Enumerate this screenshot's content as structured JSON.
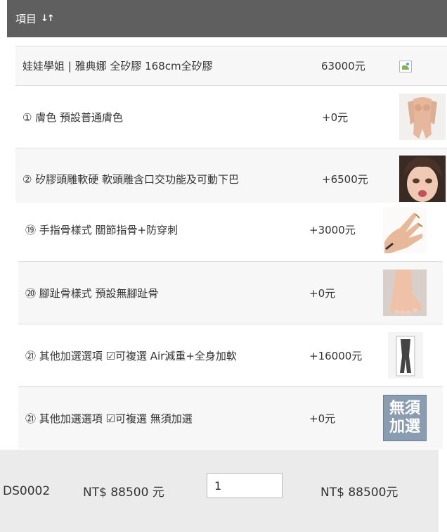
{
  "header": {
    "title": "項目"
  },
  "rows": [
    {
      "name": "娃娃學姐 | 雅典娜 全矽膠 168cm全矽膠",
      "price": "63000元",
      "thumb": "broken-image-icon"
    },
    {
      "name": "① 膚色 預設普通膚色",
      "price": "+0元",
      "thumb": "skin-tone-image"
    },
    {
      "name": "② 矽膠頭雕軟硬 軟頭雕含口交功能及可動下巴",
      "price": "+6500元",
      "thumb": "head-sculpt-image"
    },
    {
      "name": "⑲ 手指骨樣式 關節指骨+防穿刺",
      "price": "+3000元",
      "thumb": "finger-skeleton-image"
    },
    {
      "name": "⑳ 腳趾骨樣式 預設無腳趾骨",
      "price": "+0元",
      "thumb": "toe-skeleton-image"
    },
    {
      "name": "㉑ 其他加選選項 ☑可複選 Air減重+全身加軟",
      "price": "+16000元",
      "thumb": "body-skeleton-image"
    },
    {
      "name": "㉑ 其他加選選項 ☑可複選 無須加選",
      "price": "+0元",
      "thumb": "no-addon-image",
      "thumb_text": "無須加選"
    }
  ],
  "footer": {
    "sku": "DS0002",
    "unit_price": "NT$ 88500 元",
    "quantity": "1",
    "subtotal": "NT$ 88500元"
  }
}
